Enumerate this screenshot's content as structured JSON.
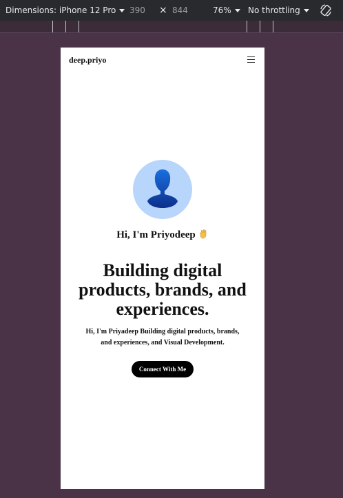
{
  "devtools": {
    "dimensions_label": "Dimensions: iPhone 12 Pro",
    "width": "390",
    "times": "×",
    "height": "844",
    "zoom": "76%",
    "throttling": "No throttling",
    "rotate_icon": "rotate-icon"
  },
  "page": {
    "brand": "deep.priyo",
    "menu_icon": "hamburger-icon",
    "greeting": "Hi, I'm Priyodeep",
    "wave_icon": "waving-hand-icon",
    "headline": "Building digital products, brands, and experiences.",
    "subtext": "Hi, I'm Priyadeep Building digital products, brands, and experiences, and Visual Development.",
    "cta_label": "Connect With Me"
  },
  "colors": {
    "backdrop": "#4a3347",
    "toolbar": "#292a2d",
    "avatar_bg": "#b8d5fb",
    "cta_bg": "#000000"
  }
}
